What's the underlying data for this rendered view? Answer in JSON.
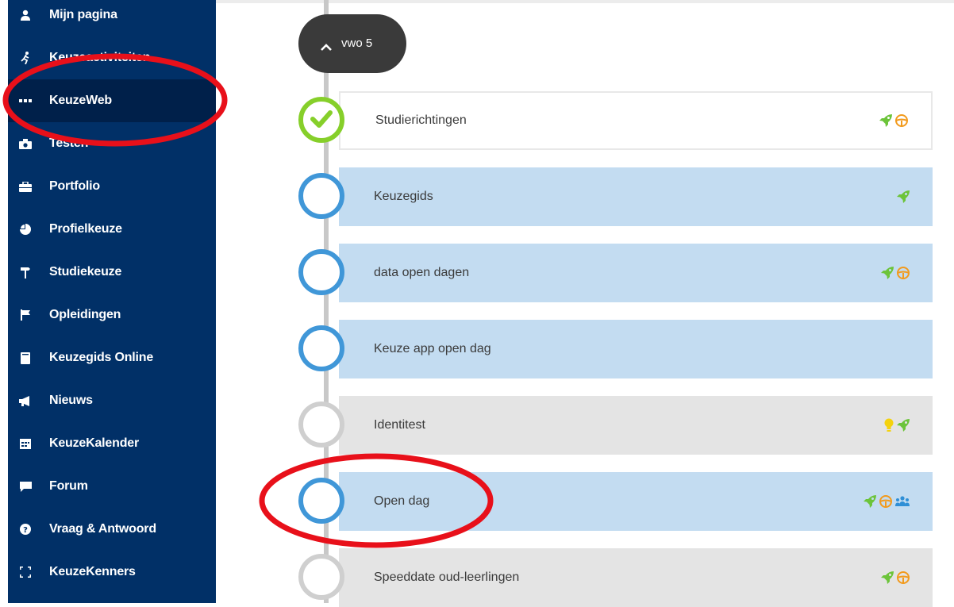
{
  "sidebar": {
    "items": [
      {
        "label": "Mijn pagina",
        "icon": "user-icon"
      },
      {
        "label": "Keuzeactiviteiten",
        "icon": "runner-icon"
      },
      {
        "label": "KeuzeWeb",
        "icon": "ellipsis-icon",
        "active": true
      },
      {
        "label": "Testen",
        "icon": "camera-icon"
      },
      {
        "label": "Portfolio",
        "icon": "briefcase-icon"
      },
      {
        "label": "Profielkeuze",
        "icon": "pie-chart-icon"
      },
      {
        "label": "Studiekeuze",
        "icon": "signpost-icon"
      },
      {
        "label": "Opleidingen",
        "icon": "flag-icon"
      },
      {
        "label": "Keuzegids Online",
        "icon": "book-icon"
      },
      {
        "label": "Nieuws",
        "icon": "megaphone-icon"
      },
      {
        "label": "KeuzeKalender",
        "icon": "calendar-icon"
      },
      {
        "label": "Forum",
        "icon": "comment-icon"
      },
      {
        "label": "Vraag & Antwoord",
        "icon": "question-circle-icon"
      },
      {
        "label": "KeuzeKenners",
        "icon": "expand-icon"
      }
    ]
  },
  "timeline": {
    "year_label": "vwo 5",
    "steps": [
      {
        "label": "Studierichtingen",
        "status": "done",
        "icons": [
          "rocket-icon",
          "steering-wheel-icon"
        ]
      },
      {
        "label": "Keuzegids",
        "status": "open",
        "icons": [
          "rocket-icon"
        ]
      },
      {
        "label": "data open dagen",
        "status": "open",
        "icons": [
          "rocket-icon",
          "steering-wheel-icon"
        ]
      },
      {
        "label": "Keuze app open dag",
        "status": "open",
        "icons": []
      },
      {
        "label": "Identitest",
        "status": "locked",
        "icons": [
          "lightbulb-icon",
          "rocket-icon"
        ]
      },
      {
        "label": "Open dag",
        "status": "open",
        "icons": [
          "rocket-icon",
          "steering-wheel-icon",
          "group-icon"
        ]
      },
      {
        "label": "Speeddate oud-leerlingen",
        "status": "locked",
        "icons": [
          "rocket-icon",
          "steering-wheel-icon"
        ]
      }
    ]
  },
  "colors": {
    "sidebar_bg": "#013067",
    "sidebar_active_bg": "#00204a",
    "step_blue": "#c3dcf1",
    "step_grey": "#e4e4e4",
    "circle_blue": "#4097d8",
    "circle_done": "#86cf2a",
    "annotation_red": "#e8101a",
    "rocket_green": "#6cc43a",
    "wheel_orange": "#f29a1c",
    "bulb_yellow": "#f4d20e",
    "group_blue": "#2f8fd6"
  }
}
